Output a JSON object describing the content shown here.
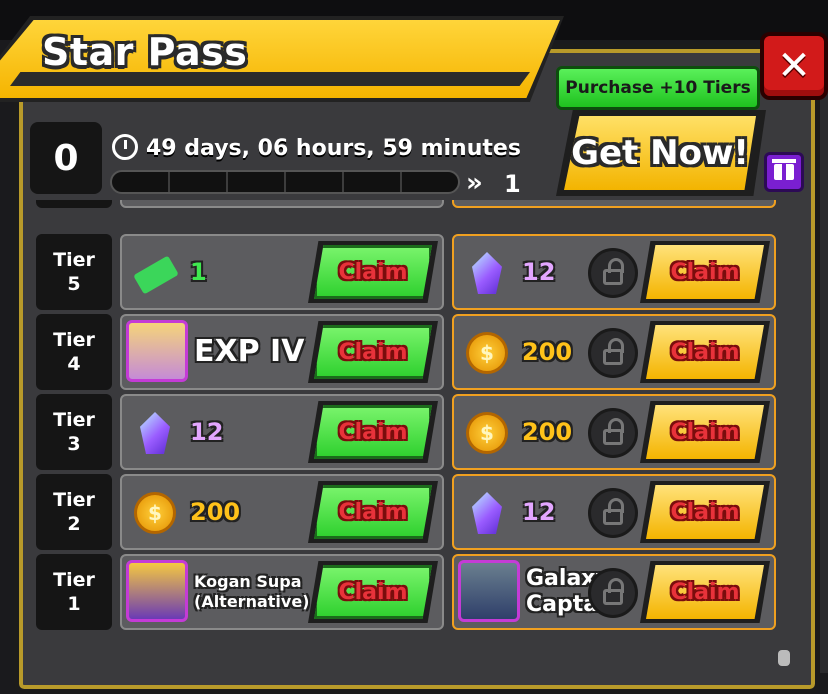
{
  "title": "Star Pass",
  "current_tier": "0",
  "timer": "49 days, 06 hours, 59 minutes",
  "next_tier": "1",
  "purchase_label": "Purchase +10 Tiers",
  "get_now_label": "Get Now!",
  "close_label": "✕",
  "tiers": [
    {
      "label_line1": "Tier",
      "label_line2": "5",
      "free": {
        "icon": "cash-ticket-icon",
        "value": "1",
        "claim": "Claim"
      },
      "premium": {
        "icon": "gem-icon",
        "value": "12",
        "claim": "Claim"
      }
    },
    {
      "label_line1": "Tier",
      "label_line2": "4",
      "free": {
        "icon": "exp-character-icon",
        "value": "EXP IV",
        "claim": "Claim"
      },
      "premium": {
        "icon": "coin-icon",
        "value": "200",
        "claim": "Claim"
      }
    },
    {
      "label_line1": "Tier",
      "label_line2": "3",
      "free": {
        "icon": "gem-icon",
        "value": "12",
        "claim": "Claim"
      },
      "premium": {
        "icon": "coin-icon",
        "value": "200",
        "claim": "Claim"
      }
    },
    {
      "label_line1": "Tier",
      "label_line2": "2",
      "free": {
        "icon": "coin-icon",
        "value": "200",
        "claim": "Claim"
      },
      "premium": {
        "icon": "gem-icon",
        "value": "12",
        "claim": "Claim"
      }
    },
    {
      "label_line1": "Tier",
      "label_line2": "1",
      "free": {
        "icon": "kogan-portrait-icon",
        "value_line1": "Kogan Supa",
        "value_line2": "(Alternative)",
        "claim": "Claim"
      },
      "premium": {
        "icon": "galaxy-portrait-icon",
        "value_line1": "Galaxy",
        "value_line2": "Captain",
        "claim": "Claim"
      }
    }
  ],
  "colors": {
    "accent": "#f5b400",
    "claim_free": "#2ccf2c",
    "claim_premium": "#f4b400",
    "close": "#d21a1a"
  }
}
